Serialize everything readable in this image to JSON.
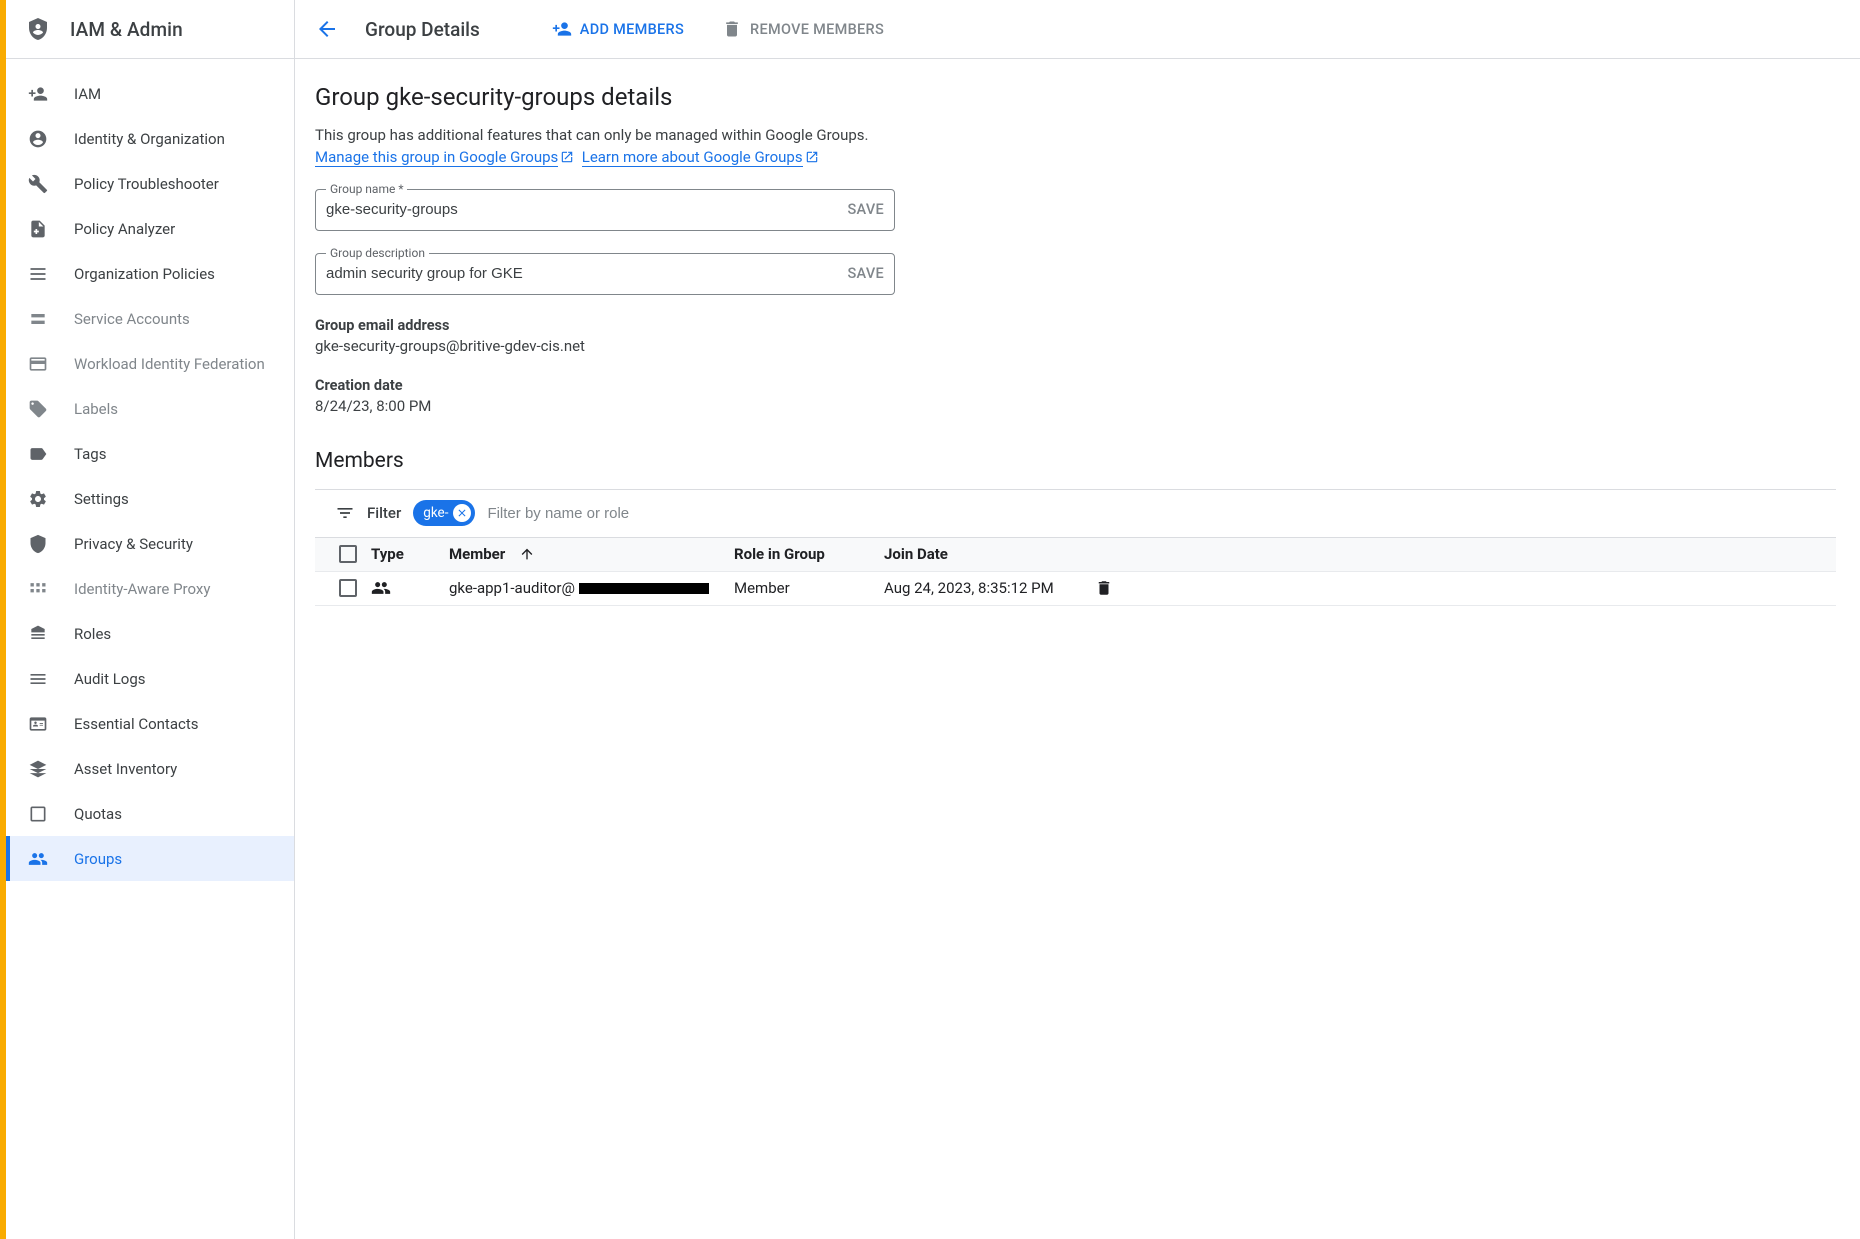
{
  "sidebar": {
    "title": "IAM & Admin",
    "items": [
      {
        "label": "IAM",
        "active": false,
        "disabled": false
      },
      {
        "label": "Identity & Organization",
        "active": false,
        "disabled": false
      },
      {
        "label": "Policy Troubleshooter",
        "active": false,
        "disabled": false
      },
      {
        "label": "Policy Analyzer",
        "active": false,
        "disabled": false
      },
      {
        "label": "Organization Policies",
        "active": false,
        "disabled": false
      },
      {
        "label": "Service Accounts",
        "active": false,
        "disabled": true
      },
      {
        "label": "Workload Identity Federation",
        "active": false,
        "disabled": true
      },
      {
        "label": "Labels",
        "active": false,
        "disabled": true
      },
      {
        "label": "Tags",
        "active": false,
        "disabled": false
      },
      {
        "label": "Settings",
        "active": false,
        "disabled": false
      },
      {
        "label": "Privacy & Security",
        "active": false,
        "disabled": false
      },
      {
        "label": "Identity-Aware Proxy",
        "active": false,
        "disabled": true
      },
      {
        "label": "Roles",
        "active": false,
        "disabled": false
      },
      {
        "label": "Audit Logs",
        "active": false,
        "disabled": false
      },
      {
        "label": "Essential Contacts",
        "active": false,
        "disabled": false
      },
      {
        "label": "Asset Inventory",
        "active": false,
        "disabled": false
      },
      {
        "label": "Quotas",
        "active": false,
        "disabled": false
      },
      {
        "label": "Groups",
        "active": true,
        "disabled": false
      }
    ]
  },
  "header": {
    "page_title": "Group Details",
    "add_members": "Add Members",
    "remove_members": "Remove Members"
  },
  "details": {
    "heading": "Group gke-security-groups details",
    "description_prefix": "This group has additional features that can only be managed within Google Groups.",
    "link_manage": "Manage this group in Google Groups",
    "link_learn": "Learn more about Google Groups",
    "group_name_label": "Group name *",
    "group_name_value": "gke-security-groups",
    "group_desc_label": "Group description",
    "group_desc_value": "admin security group for GKE",
    "save_label": "SAVE",
    "email_label": "Group email address",
    "email_value": "gke-security-groups@britive-gdev-cis.net",
    "creation_label": "Creation date",
    "creation_value": "8/24/23, 8:00 PM"
  },
  "members": {
    "heading": "Members",
    "filter_label": "Filter",
    "filter_chip": "gke-",
    "filter_placeholder": "Filter by name or role",
    "columns": {
      "type": "Type",
      "member": "Member",
      "role": "Role in Group",
      "join": "Join Date"
    },
    "rows": [
      {
        "member_prefix": "gke-app1-auditor@",
        "role": "Member",
        "join": "Aug 24, 2023, 8:35:12 PM"
      }
    ]
  }
}
